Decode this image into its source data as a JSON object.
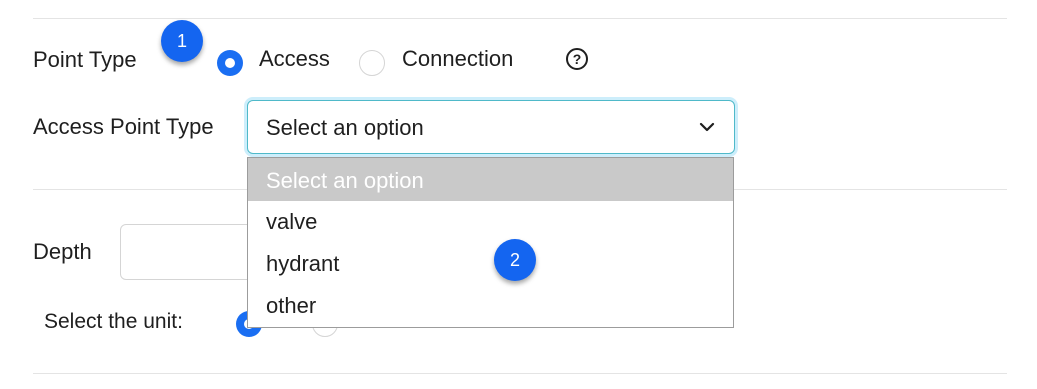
{
  "point_type": {
    "label": "Point Type",
    "options": [
      {
        "label": "Access",
        "checked": true
      },
      {
        "label": "Connection",
        "checked": false
      }
    ],
    "help_icon": "?"
  },
  "access_point_type": {
    "label": "Access Point Type",
    "selected_value": "Select an option",
    "options": [
      "Select an option",
      "valve",
      "hydrant",
      "other"
    ]
  },
  "depth": {
    "label": "Depth",
    "value": ""
  },
  "unit": {
    "label": "Select the unit:"
  },
  "badges": [
    "1",
    "2"
  ],
  "colors": {
    "accent": "#1a6ef2",
    "badge": "#1465f0",
    "focus_border": "#4fb9c9",
    "option_highlight": "#c9c9c9"
  }
}
